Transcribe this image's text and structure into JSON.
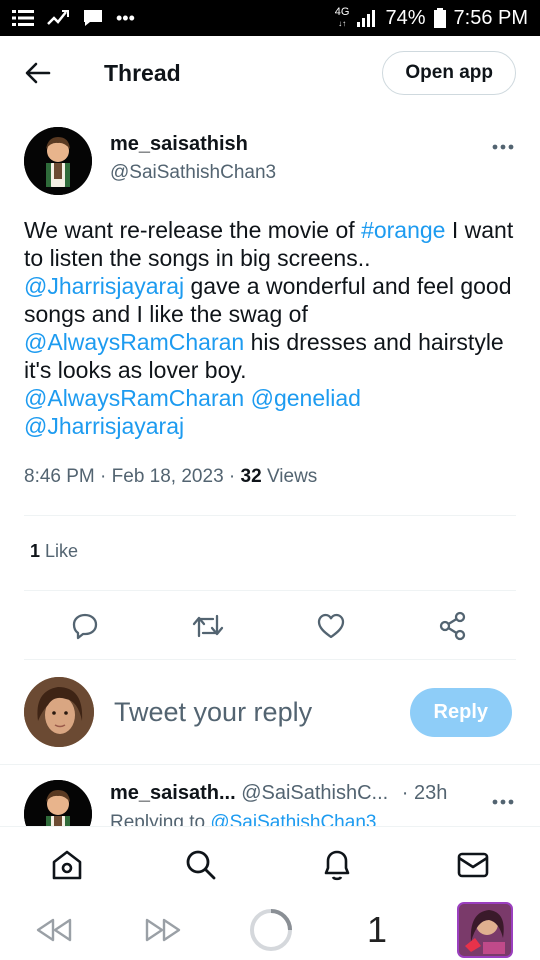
{
  "statusbar": {
    "network": "4G",
    "battery": "74%",
    "time": "7:56 PM"
  },
  "header": {
    "title": "Thread",
    "open_app": "Open app"
  },
  "tweet": {
    "display_name": "me_saisathish",
    "handle": "@SaiSathishChan3",
    "segments": [
      {
        "text": "We want re-release the movie of ",
        "type": "text"
      },
      {
        "text": "#orange",
        "type": "mention"
      },
      {
        "text": " I want to listen the songs in big screens.. ",
        "type": "text"
      },
      {
        "text": "@Jharrisjayaraj",
        "type": "mention"
      },
      {
        "text": " gave a wonderful and feel good songs and I like the swag of ",
        "type": "text"
      },
      {
        "text": "@AlwaysRamCharan",
        "type": "mention"
      },
      {
        "text": " his dresses and hairstyle it's looks as lover boy.\n",
        "type": "text"
      },
      {
        "text": "@AlwaysRamCharan",
        "type": "mention"
      },
      {
        "text": " ",
        "type": "text"
      },
      {
        "text": "@geneliad",
        "type": "mention"
      },
      {
        "text": "\n",
        "type": "text"
      },
      {
        "text": "@Jharrisjayaraj",
        "type": "mention"
      }
    ],
    "time": "8:46 PM",
    "date": "Feb 18, 2023",
    "views_count": "32",
    "views_label": "Views",
    "likes_count": "1",
    "likes_label": "Like"
  },
  "reply": {
    "placeholder": "Tweet your reply",
    "button": "Reply"
  },
  "second_tweet": {
    "display_name": "me_saisath...",
    "handle": "@SaiSathishC...",
    "age": "· 23h",
    "replying_prefix": "Replying to",
    "replying_to": "@SaiSathishChan3"
  },
  "sysnav": {
    "tab_count": "1"
  },
  "colors": {
    "accent": "#1d9bf0",
    "reply_button": "#8ecdf8",
    "text": "#0f1419",
    "secondary": "#536471"
  },
  "icons": [
    "back-arrow-icon",
    "more-icon",
    "reply-icon",
    "retweet-icon",
    "like-icon",
    "share-icon",
    "home-icon",
    "search-icon",
    "notifications-icon",
    "messages-icon"
  ]
}
